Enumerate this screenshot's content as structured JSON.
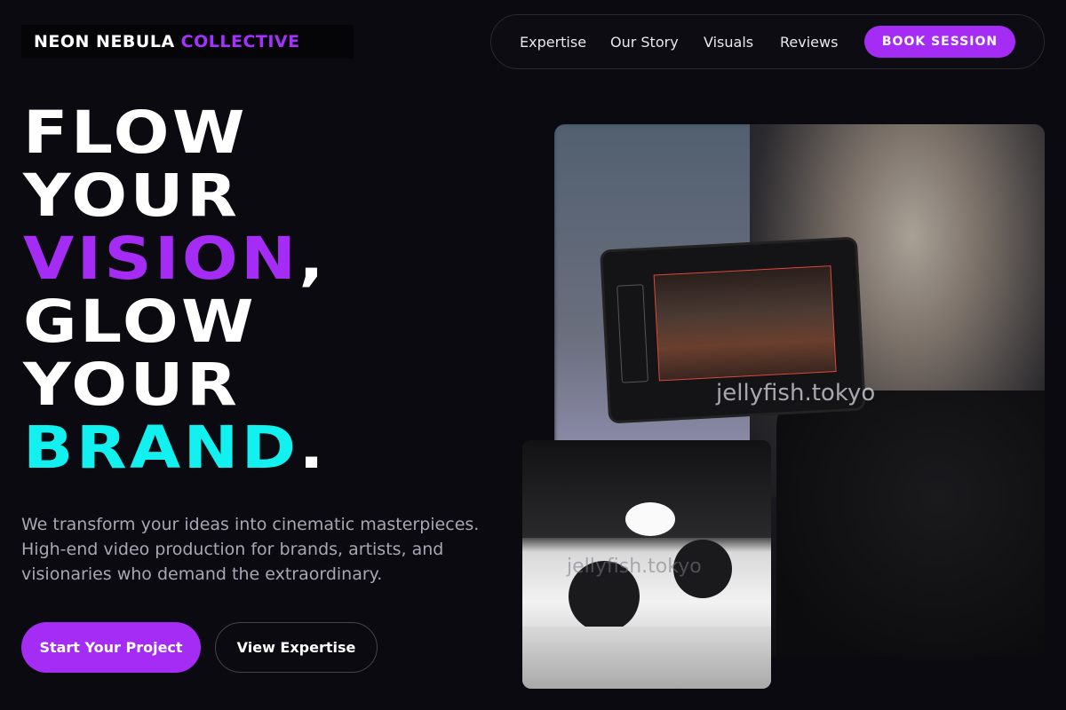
{
  "brand": {
    "name_primary": "NEON NEBULA",
    "name_accent": "COLLECTIVE"
  },
  "nav": {
    "items": [
      "Expertise",
      "Our Story",
      "Visuals",
      "Reviews"
    ],
    "cta": "BOOK SESSION"
  },
  "hero": {
    "line1": "FLOW",
    "line2": "YOUR",
    "line3_accent": "VISION",
    "line3_punct": ",",
    "line4": "GLOW",
    "line5": "YOUR",
    "line6_accent": "BRAND",
    "line6_punct": ".",
    "subtitle": "We transform your ideas into cinematic masterpieces. High-end video production for brands, artists, and visionaries who demand the extraordinary."
  },
  "buttons": {
    "primary": "Start Your Project",
    "secondary": "View Expertise"
  },
  "images": {
    "main_watermark": "jellyfish.tokyo",
    "small_watermark": "jellyfish.tokyo"
  },
  "colors": {
    "accent_purple": "#a42cf5",
    "accent_cyan": "#12f0f0",
    "background": "#0b0a10"
  }
}
